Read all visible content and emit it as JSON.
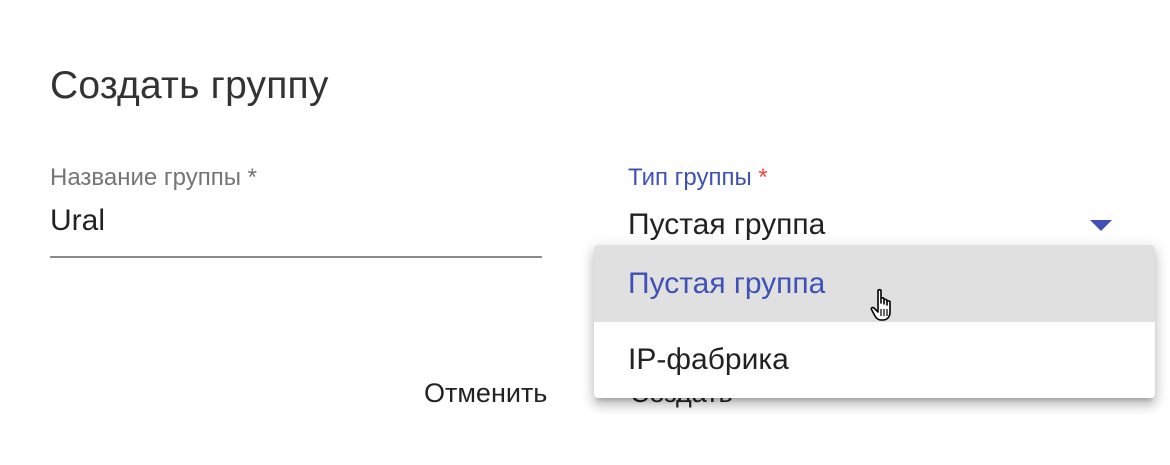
{
  "dialog": {
    "title": "Создать группу"
  },
  "fields": {
    "name": {
      "label": "Название группы",
      "required_mark": " *",
      "value": "Ural"
    },
    "type": {
      "label": "Тип группы",
      "required_mark": " *",
      "value": "Пустая группа",
      "arrow_icon": "arrow-drop-down-icon"
    }
  },
  "menu": {
    "options": [
      {
        "label": "Пустая группа",
        "selected": true
      },
      {
        "label": "IP-фабрика",
        "selected": false
      }
    ]
  },
  "actions": {
    "cancel_label": "Отменить",
    "create_label": "Создать"
  },
  "colors": {
    "accent": "#3f51b5",
    "required": "#f44336",
    "selected_bg": "#e0e0e0"
  },
  "cursor": {
    "icon": "hand-pointer-icon"
  }
}
